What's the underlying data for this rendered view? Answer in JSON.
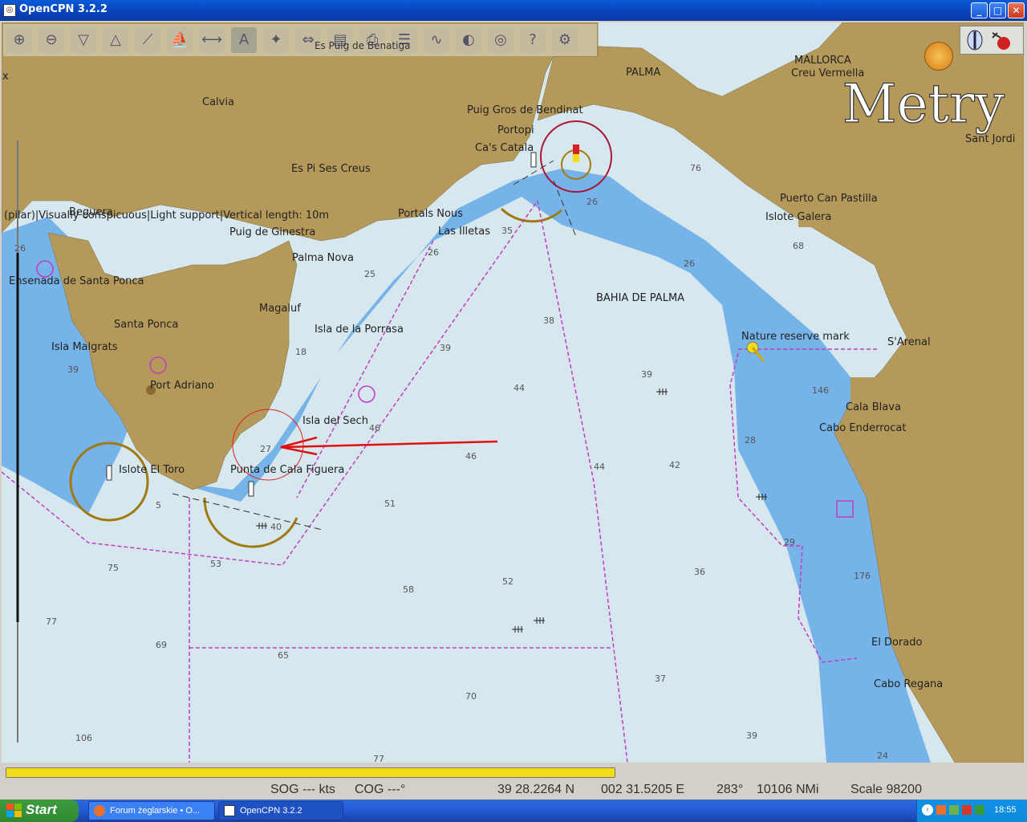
{
  "window": {
    "title": "OpenCPN 3.2.2",
    "minimize": "_",
    "maximize": "□",
    "close": "✕"
  },
  "toolbar": {
    "tooltip": "Es Puig de Benatiga",
    "buttons": [
      "zoom-in-icon",
      "zoom-out-icon",
      "scale-down-icon",
      "scale-up-icon",
      "route-icon",
      "ship-icon",
      "measure-icon",
      "text-icon",
      "lights-icon",
      "ais-icon",
      "chart-quilt-icon",
      "print-icon",
      "route-manager-icon",
      "tracks-icon",
      "color-scheme-icon",
      "mob-icon",
      "help-icon",
      "settings-icon"
    ]
  },
  "overlay": {
    "watermark": "Metry",
    "close_x": "x",
    "object_info": "(pilar)|Visually conspicuous|Light support|Vertical length: 10m"
  },
  "map": {
    "places": [
      "MALLORCA",
      "Creu Vermella",
      "PALMA",
      "Calvia",
      "Puig Gros de Bendinat",
      "Portopi",
      "Ca's Catala",
      "Es Pi Ses Creus",
      "Sant Jordi",
      "Puerto Can Pastilla",
      "Islote Galera",
      "Beguera",
      "Portals Nous",
      "Las Illetas",
      "Puig de Ginestra",
      "Palma Nova",
      "Ensenada de Santa Ponca",
      "BAHIA DE PALMA",
      "Magaluf",
      "Santa Ponca",
      "Isla de la Porrasa",
      "Isla Malgrats",
      "Nature reserve mark",
      "S'Arenal",
      "Port Adriano",
      "Isla del Sech",
      "Cala Blava",
      "Cabo Enderrocat",
      "Islote El Toro",
      "Punta de Cala Figuera",
      "El Dorado",
      "Cabo Regana"
    ],
    "soundings": [
      "26",
      "76",
      "26",
      "35",
      "26",
      "68",
      "25",
      "26",
      "38",
      "18",
      "39",
      "39",
      "44",
      "39",
      "46",
      "146",
      "46",
      "27",
      "44",
      "42",
      "28",
      "5",
      "51",
      "40",
      "53",
      "75",
      "52",
      "36",
      "29",
      "58",
      "176",
      "77",
      "69",
      "65",
      "37",
      "70",
      "106",
      "77",
      "39",
      "24"
    ]
  },
  "status": {
    "sog": "SOG --- kts",
    "cog": "COG ---°",
    "lat": "39 28.2264 N",
    "lon": "002 31.5205 E",
    "bearing": "283°",
    "distance": "10106 NMi",
    "scale": "Scale 98200",
    "progress": 0.6
  },
  "taskbar": {
    "start": "Start",
    "tasks": [
      "Forum żeglarskie • O...",
      "OpenCPN 3.2.2"
    ],
    "clock": "18:55"
  },
  "colors": {
    "land": "#b5995a",
    "shallow": "#75b3e8",
    "deep": "#d7e7ee",
    "magenta": "#c43bc4"
  }
}
